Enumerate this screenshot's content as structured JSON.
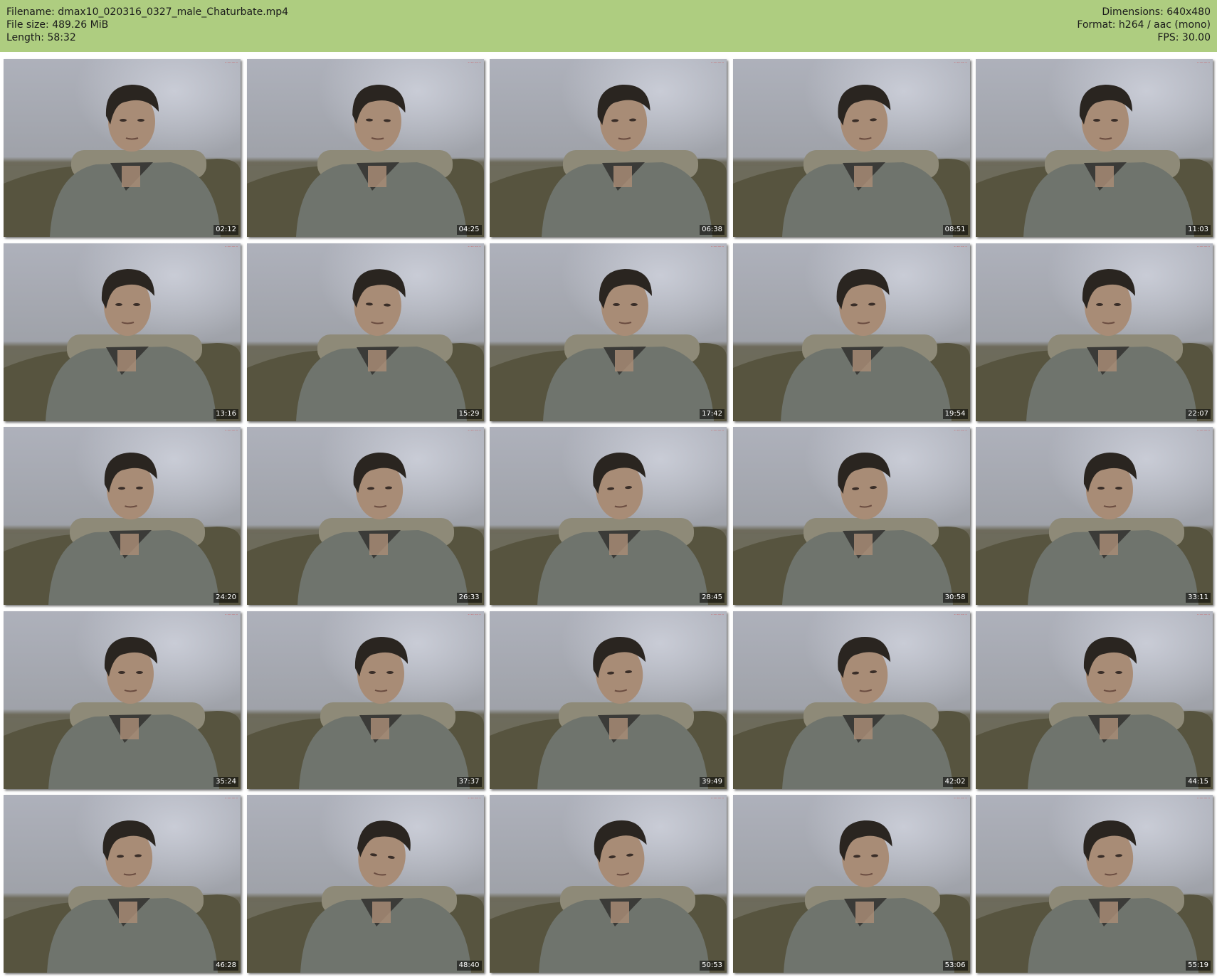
{
  "header": {
    "filename": "Filename: dmax10_020316_0327_male_Chaturbate.mp4",
    "file_size": "File size: 489.26 MiB",
    "length": "Length: 58:32",
    "dimensions": "Dimensions: 640x480",
    "format": "Format: h264 / aac (mono)",
    "fps": "FPS: 30.00"
  },
  "thumbnails": [
    {
      "timestamp": "02:12"
    },
    {
      "timestamp": "04:25"
    },
    {
      "timestamp": "06:38"
    },
    {
      "timestamp": "08:51"
    },
    {
      "timestamp": "11:03"
    },
    {
      "timestamp": "13:16"
    },
    {
      "timestamp": "15:29"
    },
    {
      "timestamp": "17:42"
    },
    {
      "timestamp": "19:54"
    },
    {
      "timestamp": "22:07"
    },
    {
      "timestamp": "24:20"
    },
    {
      "timestamp": "26:33"
    },
    {
      "timestamp": "28:45"
    },
    {
      "timestamp": "30:58"
    },
    {
      "timestamp": "33:11"
    },
    {
      "timestamp": "35:24"
    },
    {
      "timestamp": "37:37"
    },
    {
      "timestamp": "39:49"
    },
    {
      "timestamp": "42:02"
    },
    {
      "timestamp": "44:15"
    },
    {
      "timestamp": "46:28"
    },
    {
      "timestamp": "48:40"
    },
    {
      "timestamp": "50:53"
    },
    {
      "timestamp": "53:06"
    },
    {
      "timestamp": "55:19"
    }
  ],
  "colors": {
    "header_bg": "#aecd80",
    "wall": "#aeb1bb",
    "couch": "#6e6b5c",
    "shirt": "#6f746d",
    "hair": "#2a2520",
    "skin": "#a88c76"
  }
}
